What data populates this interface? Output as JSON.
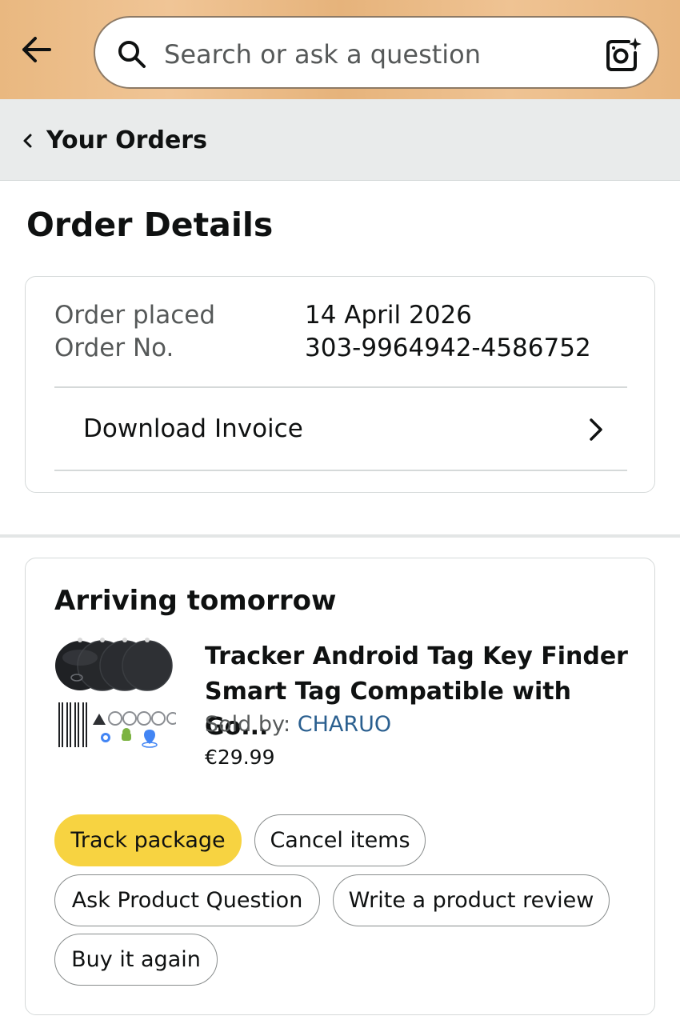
{
  "header": {
    "search_placeholder": "Search or ask a question",
    "back_icon": "back-arrow-icon",
    "search_icon": "magnifier-icon",
    "camera_icon": "camera-sparkle-icon"
  },
  "breadcrumb": {
    "label": "Your Orders",
    "icon": "chevron-left-icon"
  },
  "page_title": "Order Details",
  "order_info": {
    "placed_label": "Order placed",
    "placed_value": "14 April 2026",
    "number_label": "Order No.",
    "number_value": "303-9964942-4586752",
    "invoice_label": "Download Invoice"
  },
  "shipment": {
    "status": "Arriving tomorrow",
    "product_title": "Tracker Android Tag Key Finder Smart Tag Compatible with Go...",
    "sold_by_label": "Sold by: ",
    "seller": "CHARUO",
    "price": "€29.99",
    "actions": {
      "track": "Track package",
      "cancel": "Cancel items",
      "ask": "Ask Product Question",
      "review": "Write a product review",
      "buy_again": "Buy it again"
    }
  },
  "colors": {
    "header_bg": "#ebbc86",
    "primary_button": "#f7d341",
    "link": "#2a5f8f",
    "breadcrumb_bg": "#e9ebeb"
  }
}
